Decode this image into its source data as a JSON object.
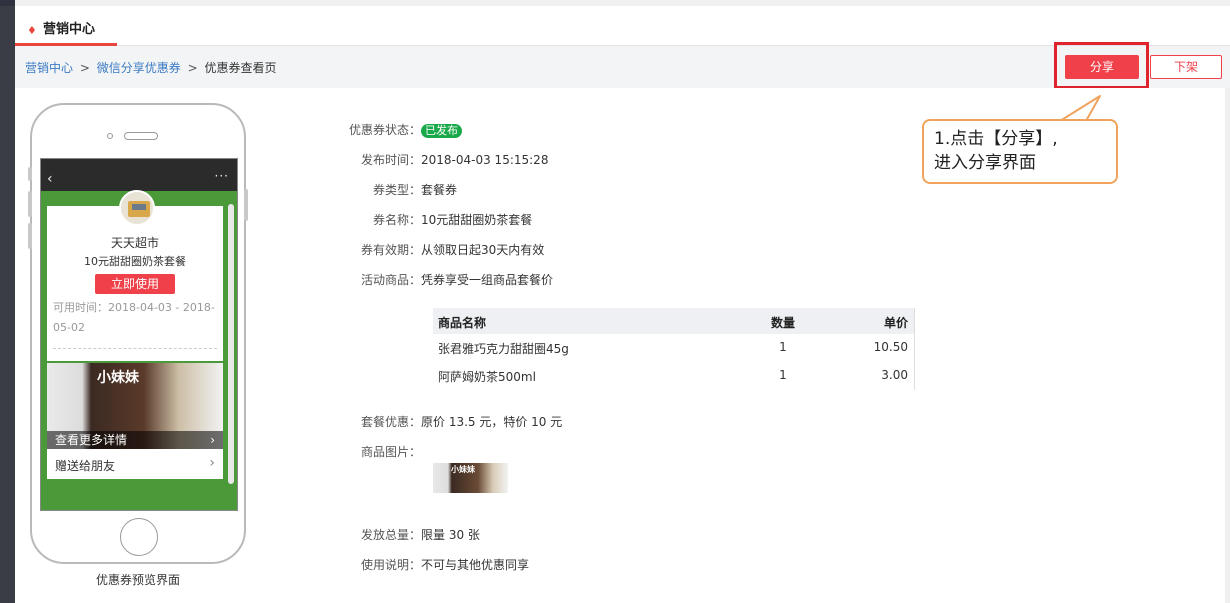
{
  "tab": {
    "label": "营销中心"
  },
  "breadcrumb": {
    "level1": "营销中心",
    "level2": "微信分享优惠券",
    "level3": "优惠券查看页",
    "separator": ">"
  },
  "actions": {
    "share_label": "分享",
    "offshelf_label": "下架"
  },
  "callout": {
    "line1": "1.点击【分享】,",
    "line2": "进入分享界面"
  },
  "phone": {
    "shop_name": "天天超市",
    "coupon_name": "10元甜甜圈奶茶套餐",
    "use_button": "立即使用",
    "avail_time": "可用时间：2018-04-03 - 2018-05-02",
    "more_details": "查看更多详情",
    "gift_friend": "赠送给朋友",
    "image_text": "小妹妹",
    "caption": "优惠券预览界面"
  },
  "details": {
    "status_label": "优惠券状态：",
    "status_value": "已发布",
    "publish_label": "发布时间：",
    "publish_value": "2018-04-03 15:15:28",
    "type_label": "券类型：",
    "type_value": "套餐券",
    "name_label": "券名称：",
    "name_value": "10元甜甜圈奶茶套餐",
    "validity_label": "券有效期：",
    "validity_value": "从领取日起30天内有效",
    "goods_label": "活动商品：",
    "goods_value": "凭券享受一组商品套餐价",
    "discount_label": "套餐优惠：",
    "discount_value": "原价 13.5 元，特价 10 元",
    "image_label": "商品图片：",
    "total_label": "发放总量：",
    "total_value": "限量 30 张",
    "usage_label": "使用说明：",
    "usage_value": "不可与其他优惠同享"
  },
  "table": {
    "headers": [
      "商品名称",
      "数量",
      "单价"
    ],
    "rows": [
      [
        "张君雅巧克力甜甜圈45g",
        "1",
        "10.50"
      ],
      [
        "阿萨姆奶茶500ml",
        "1",
        "3.00"
      ]
    ]
  },
  "colors": {
    "accent": "#f0414a",
    "badge": "#1aa94a",
    "link": "#3b7bc2",
    "callout_border": "#f0a35d"
  }
}
